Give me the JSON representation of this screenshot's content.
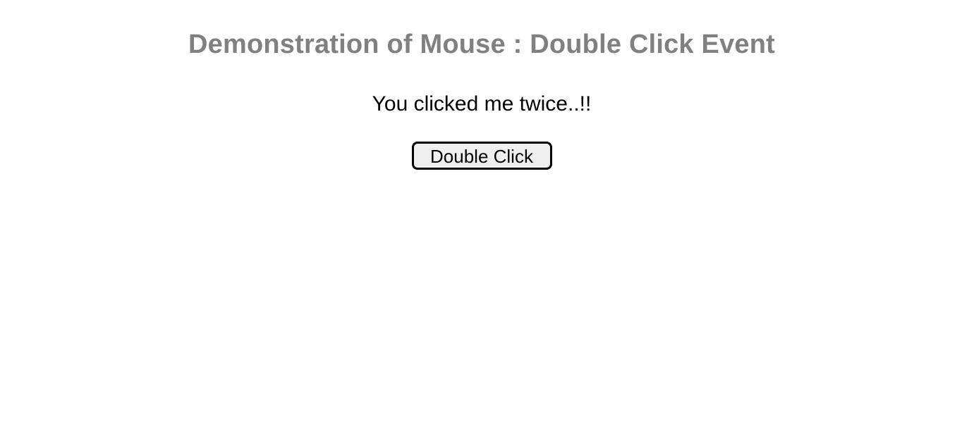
{
  "heading": "Demonstration of Mouse : Double Click Event",
  "message": "You clicked me twice..!!",
  "button": {
    "label": "Double Click"
  },
  "colors": {
    "heading": "#808080",
    "text": "#000000",
    "button_bg": "#efefef",
    "button_border": "#000000",
    "page_bg": "#ffffff"
  }
}
